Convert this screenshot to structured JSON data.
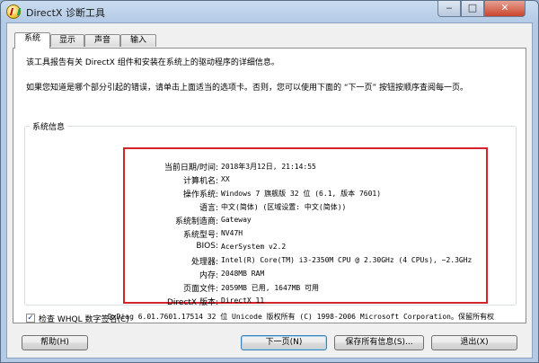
{
  "window": {
    "title": "DirectX 诊断工具",
    "minimize_glyph": "‒",
    "maximize_glyph": "□",
    "close_glyph": "✕"
  },
  "tabs": [
    {
      "label": "系统",
      "active": true
    },
    {
      "label": "显示",
      "active": false
    },
    {
      "label": "声音",
      "active": false
    },
    {
      "label": "输入",
      "active": false
    }
  ],
  "description": {
    "line1": "该工具报告有关 DirectX 组件和安装在系统上的驱动程序的详细信息。",
    "line2": "如果您知道是哪个部分引起的错误，请单击上面适当的选项卡。否则，您可以使用下面的 “下一页” 按钮按顺序查阅每一页。"
  },
  "system_info": {
    "group_label": "系统信息",
    "rows": [
      {
        "label": "当前日期/时间:",
        "value": "2018年3月12日, 21:14:55"
      },
      {
        "label": "计算机名:",
        "value": "XX"
      },
      {
        "label": "操作系统:",
        "value": "Windows 7 旗舰版 32 位 (6.1, 版本 7601)"
      },
      {
        "label": "语言:",
        "value": "中文(简体) (区域设置: 中文(简体))"
      },
      {
        "label": "系统制造商:",
        "value": "Gateway"
      },
      {
        "label": "系统型号:",
        "value": "NV47H"
      },
      {
        "label": "BIOS:",
        "value": "AcerSystem v2.2"
      },
      {
        "label": "处理器:",
        "value": "Intel(R) Core(TM) i3-2350M CPU @ 2.30GHz (4 CPUs), ~2.3GHz"
      },
      {
        "label": "内存:",
        "value": "2048MB RAM"
      },
      {
        "label": "页面文件:",
        "value": "2059MB 已用, 1647MB 可用"
      },
      {
        "label": "DirectX 版本:",
        "value": "DirectX 11"
      }
    ]
  },
  "whql": {
    "checked": true,
    "check_glyph": "✓",
    "label": "检查 WHQL 数字签名(C)"
  },
  "copyright": "DxDiag 6.01.7601.17514 32 位 Unicode 版权所有 (C) 1998-2006 Microsoft Corporation。保留所有权",
  "buttons": {
    "help": "帮助(H)",
    "next": "下一页(N)",
    "save": "保存所有信息(S)...",
    "exit": "退出(X)"
  },
  "colors": {
    "highlight_border": "#d4242b",
    "default_button_border": "#3c7fb1"
  }
}
